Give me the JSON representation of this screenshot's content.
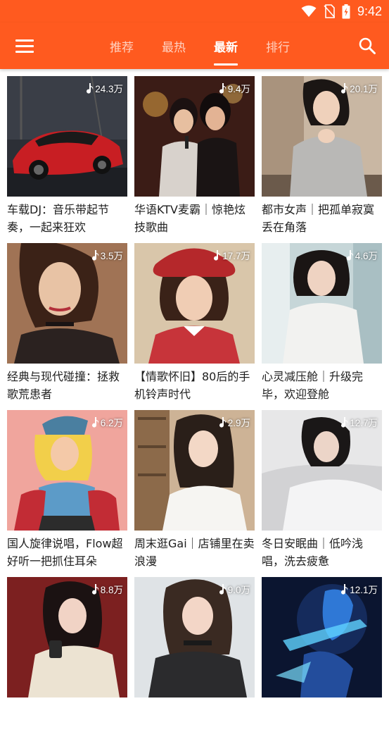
{
  "status_bar": {
    "time": "9:42",
    "icons": [
      "wifi-icon",
      "no-sim-icon",
      "battery-charging-icon"
    ]
  },
  "app_bar": {
    "menu_icon": "hamburger-menu-icon",
    "search_icon": "search-icon",
    "tabs": [
      {
        "label": "推荐",
        "active": false
      },
      {
        "label": "最热",
        "active": false
      },
      {
        "label": "最新",
        "active": true
      },
      {
        "label": "排行",
        "active": false
      }
    ]
  },
  "colors": {
    "brand": "#ff5a1f",
    "text": "#1e1e1e"
  },
  "playlists": [
    {
      "title": "车载DJ：音乐带起节奏，一起来狂欢",
      "plays": "24.3万"
    },
    {
      "title": "华语KTV麦霸｜惊艳炫技歌曲",
      "plays": "9.4万"
    },
    {
      "title": "都市女声｜把孤单寂寞丢在角落",
      "plays": "20.1万"
    },
    {
      "title": "经典与现代碰撞：拯救歌荒患者",
      "plays": "3.5万"
    },
    {
      "title": "【情歌怀旧】80后的手机铃声时代",
      "plays": "17.7万"
    },
    {
      "title": "心灵减压舱｜升级完毕，欢迎登舱",
      "plays": "4.6万"
    },
    {
      "title": "国人旋律说唱，Flow超好听一把抓住耳朵",
      "plays": "6.2万"
    },
    {
      "title": "周末逛Gai｜店铺里在卖浪漫",
      "plays": "2.9万"
    },
    {
      "title": "冬日安眠曲｜低吟浅唱，洗去疲惫",
      "plays": "12.7万"
    },
    {
      "title": "",
      "plays": "8.8万"
    },
    {
      "title": "",
      "plays": "9.0万"
    },
    {
      "title": "",
      "plays": "12.1万"
    }
  ]
}
